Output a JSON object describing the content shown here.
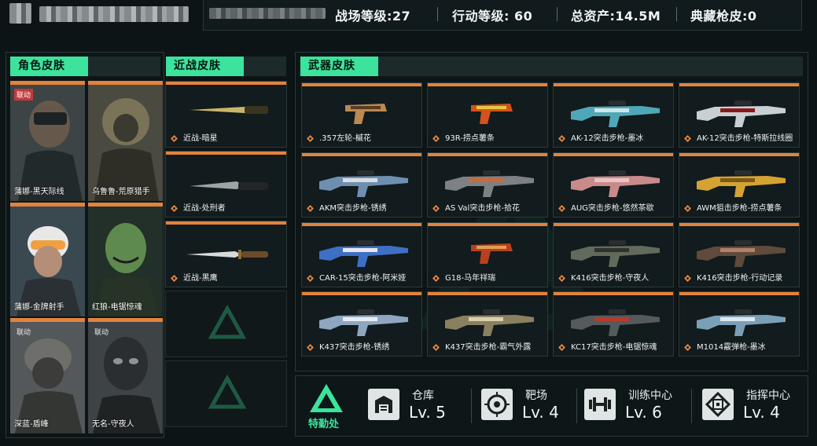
{
  "header": {
    "stats": [
      {
        "label": "战场等级:27"
      },
      {
        "label": "行动等级: 60"
      },
      {
        "label": "总资产:14.5M"
      },
      {
        "label": "典藏枪皮:0"
      }
    ]
  },
  "character_panel": {
    "title": "角色皮肤",
    "items": [
      {
        "label": "蒲娜-黑天际线",
        "tag": "联动"
      },
      {
        "label": "乌鲁鲁-荒原猎手",
        "tag": ""
      },
      {
        "label": "蒲娜-金牌射手",
        "tag": ""
      },
      {
        "label": "红狼-电锯惊魂",
        "tag": ""
      },
      {
        "label": "深蓝-盾峰",
        "tag": "联动"
      },
      {
        "label": "无名-守夜人",
        "tag": "联动"
      }
    ]
  },
  "melee_panel": {
    "title": "近战皮肤",
    "items": [
      {
        "label": "近战-暗星"
      },
      {
        "label": "近战-处刑者"
      },
      {
        "label": "近战-黑鹰"
      }
    ]
  },
  "weapon_panel": {
    "title": "武器皮肤",
    "items": [
      {
        "label": ".357左轮-槭花"
      },
      {
        "label": "93R-捞点薯条"
      },
      {
        "label": "AK-12突击步枪-墨冰"
      },
      {
        "label": "AK-12突击步枪-特斯拉线圈"
      },
      {
        "label": "AKM突击步枪-锈绣"
      },
      {
        "label": "AS Val突击步枪-拾花"
      },
      {
        "label": "AUG突击步枪-悠然茶歇"
      },
      {
        "label": "AWM狙击步枪-捞点薯条"
      },
      {
        "label": "CAR-15突击步枪-阿米娅"
      },
      {
        "label": "G18-马年祥瑞"
      },
      {
        "label": "K416突击步枪-守夜人"
      },
      {
        "label": "K416突击步枪-行动记录"
      },
      {
        "label": "K437突击步枪-锈绣"
      },
      {
        "label": "K437突击步枪-霸气外露"
      },
      {
        "label": "KC17突击步枪-电锯惊魂"
      },
      {
        "label": "M1014霰弹枪-墨冰"
      }
    ]
  },
  "bottom": {
    "logo_label": "特勤处",
    "facilities": [
      {
        "name": "仓库",
        "level": "Lv. 5",
        "icon": "warehouse-icon"
      },
      {
        "name": "靶场",
        "level": "Lv. 4",
        "icon": "target-icon"
      },
      {
        "name": "训练中心",
        "level": "Lv. 6",
        "icon": "dumbbell-icon"
      },
      {
        "name": "指挥中心",
        "level": "Lv. 4",
        "icon": "command-icon"
      }
    ]
  },
  "colors": {
    "accent_green": "#3ce39c",
    "accent_orange": "#e2833d",
    "link_tag_red": "#c23a3a",
    "background": "#0c1415"
  }
}
